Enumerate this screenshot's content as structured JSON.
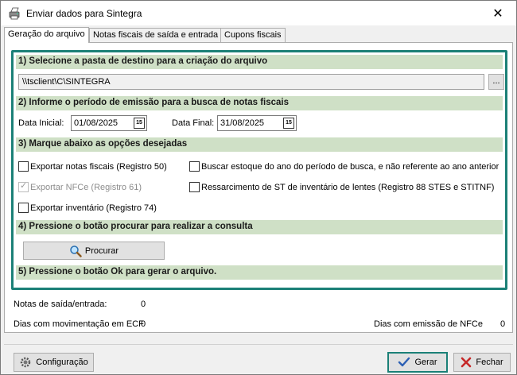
{
  "window": {
    "title": "Enviar dados para Sintegra",
    "close_glyph": "✕"
  },
  "tabs": [
    {
      "label": "Geração do arquivo",
      "active": true
    },
    {
      "label": "Notas fiscais de saída e entrada",
      "active": false
    },
    {
      "label": "Cupons fiscais",
      "active": false
    }
  ],
  "step1": {
    "header": "1) Selecione a pasta de destino para a criação do arquivo",
    "path": "\\\\tsclient\\C\\SINTEGRA",
    "browse_label": "..."
  },
  "step2": {
    "header": "2) Informe o período de emissão para a busca de notas fiscais",
    "start_label": "Data Inicial:",
    "start_value": "01/08/2025",
    "end_label": "Data Final:",
    "end_value": "31/08/2025",
    "calendar_glyph": "15"
  },
  "step3": {
    "header": "3) Marque abaixo as opções desejadas",
    "options_left": [
      {
        "label": "Exportar notas fiscais (Registro 50)",
        "checked": false,
        "disabled": false
      },
      {
        "label": "Exportar NFCe (Registro 61)",
        "checked": true,
        "disabled": true
      },
      {
        "label": "Exportar inventário (Registro 74)",
        "checked": false,
        "disabled": false
      }
    ],
    "options_right": [
      {
        "label": "Buscar estoque do ano do período de busca, e não referente ao ano anterior",
        "checked": false,
        "disabled": false
      },
      {
        "label": "Ressarcimento de ST de inventário de lentes (Registro 88 STES e STITNF)",
        "checked": false,
        "disabled": false
      }
    ]
  },
  "step4": {
    "header": "4) Pressione o botão procurar para realizar a consulta",
    "button_label": "Procurar"
  },
  "step5": {
    "header": "5) Pressione o botão Ok para gerar o arquivo."
  },
  "stats": {
    "notas_label": "Notas de saída/entrada:",
    "notas_value": "0",
    "ecf_label": "Dias com movimentação em ECF",
    "ecf_value": "0",
    "nfce_label": "Dias com emissão de NFCe",
    "nfce_value": "0"
  },
  "footer": {
    "config_label": "Configuração",
    "gerar_label": "Gerar",
    "fechar_label": "Fechar"
  },
  "colors": {
    "accent": "#1b8077",
    "section_bg": "#cfe0c6"
  }
}
